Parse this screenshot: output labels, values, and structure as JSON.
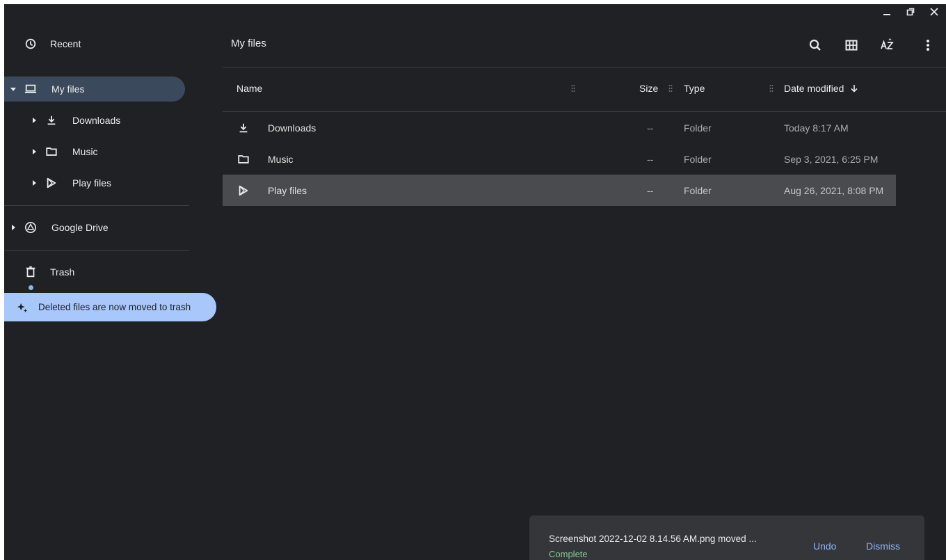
{
  "window": {
    "controls": [
      {
        "name": "minimize-icon"
      },
      {
        "name": "restore-icon"
      },
      {
        "name": "close-icon"
      }
    ]
  },
  "sidebar": {
    "recent_label": "Recent",
    "my_files_label": "My files",
    "children": [
      {
        "label": "Downloads",
        "icon": "download-icon"
      },
      {
        "label": "Music",
        "icon": "folder-icon"
      },
      {
        "label": "Play files",
        "icon": "play-store-icon"
      }
    ],
    "google_drive_label": "Google Drive",
    "trash_label": "Trash",
    "tip_text": "Deleted files are now moved to trash"
  },
  "header": {
    "title": "My files",
    "icons": [
      "search-icon",
      "grid-view-icon",
      "sort-az-icon",
      "more-vert-icon"
    ]
  },
  "columns": {
    "name": "Name",
    "size": "Size",
    "type": "Type",
    "date": "Date modified",
    "sort_direction": "descending"
  },
  "files": [
    {
      "name": "Downloads",
      "icon": "download-icon",
      "size": "--",
      "type": "Folder",
      "date": "Today 8:17 AM",
      "selected": false
    },
    {
      "name": "Music",
      "icon": "folder-icon",
      "size": "--",
      "type": "Folder",
      "date": "Sep 3, 2021, 6:25 PM",
      "selected": false
    },
    {
      "name": "Play files",
      "icon": "play-store-icon",
      "size": "--",
      "type": "Folder",
      "date": "Aug 26, 2021, 8:08 PM",
      "selected": true
    }
  ],
  "snackbar": {
    "message": "Screenshot 2022-12-02 8.14.56 AM.png moved ...",
    "status": "Complete",
    "undo_label": "Undo",
    "dismiss_label": "Dismiss"
  },
  "colors": {
    "background": "#202124",
    "accent": "#8ab4f8",
    "selected_nav": "#3a4a5c",
    "selected_row": "#494b4f",
    "tip": "#a8c7fa",
    "success": "#81c995"
  }
}
